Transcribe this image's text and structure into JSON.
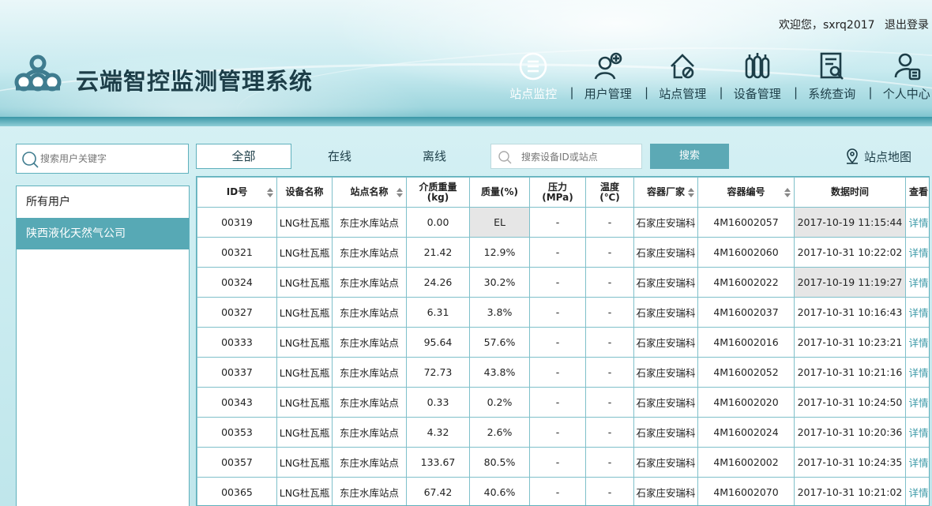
{
  "header": {
    "system_title": "云端智控监测管理系统",
    "welcome_text": "欢迎您，",
    "username": "sxrq2017",
    "logout_label": "退出登录",
    "nav": [
      {
        "label": "站点监控",
        "icon": "monitor-list-icon",
        "active": true
      },
      {
        "label": "用户管理",
        "icon": "user-add-icon"
      },
      {
        "label": "站点管理",
        "icon": "house-gear-icon"
      },
      {
        "label": "设备管理",
        "icon": "cylinders-icon"
      },
      {
        "label": "系统查询",
        "icon": "document-search-icon"
      },
      {
        "label": "个人中心",
        "icon": "person-card-icon"
      }
    ]
  },
  "sidebar": {
    "search_placeholder": "搜索用户关键字",
    "items": [
      {
        "label": "所有用户"
      },
      {
        "label": "陕西液化天然气公司",
        "selected": true
      }
    ]
  },
  "filters": {
    "all": "全部",
    "online": "在线",
    "offline": "离线",
    "search_placeholder": "搜索设备ID或站点",
    "search_button": "搜索",
    "map_link": "站点地图"
  },
  "table": {
    "columns": [
      "ID号",
      "设备名称",
      "站点名称",
      "介质重量\n(kg)",
      "质量(%)",
      "压力\n(MPa)",
      "温度\n(℃)",
      "容器厂家",
      "容器编号",
      "数据时间",
      "查看"
    ],
    "rows": [
      [
        "00319",
        "LNG杜瓦瓶",
        "东庄水库站点",
        "0.00",
        "EL",
        "-",
        "-",
        "石家庄安瑞科",
        "4M16002057",
        "2017-10-19 11:15:44",
        "详情"
      ],
      [
        "00321",
        "LNG杜瓦瓶",
        "东庄水库站点",
        "21.42",
        "12.9%",
        "-",
        "-",
        "石家庄安瑞科",
        "4M16002060",
        "2017-10-31 10:22:02",
        "详情"
      ],
      [
        "00324",
        "LNG杜瓦瓶",
        "东庄水库站点",
        "24.26",
        "30.2%",
        "-",
        "-",
        "石家庄安瑞科",
        "4M16002022",
        "2017-10-19 11:19:27",
        "详情"
      ],
      [
        "00327",
        "LNG杜瓦瓶",
        "东庄水库站点",
        "6.31",
        "3.8%",
        "-",
        "-",
        "石家庄安瑞科",
        "4M16002037",
        "2017-10-31 10:16:43",
        "详情"
      ],
      [
        "00333",
        "LNG杜瓦瓶",
        "东庄水库站点",
        "95.64",
        "57.6%",
        "-",
        "-",
        "石家庄安瑞科",
        "4M16002016",
        "2017-10-31 10:23:21",
        "详情"
      ],
      [
        "00337",
        "LNG杜瓦瓶",
        "东庄水库站点",
        "72.73",
        "43.8%",
        "-",
        "-",
        "石家庄安瑞科",
        "4M16002052",
        "2017-10-31 10:21:16",
        "详情"
      ],
      [
        "00343",
        "LNG杜瓦瓶",
        "东庄水库站点",
        "0.33",
        "0.2%",
        "-",
        "-",
        "石家庄安瑞科",
        "4M16002020",
        "2017-10-31 10:24:50",
        "详情"
      ],
      [
        "00353",
        "LNG杜瓦瓶",
        "东庄水库站点",
        "4.32",
        "2.6%",
        "-",
        "-",
        "石家庄安瑞科",
        "4M16002024",
        "2017-10-31 10:20:36",
        "详情"
      ],
      [
        "00357",
        "LNG杜瓦瓶",
        "东庄水库站点",
        "133.67",
        "80.5%",
        "-",
        "-",
        "石家庄安瑞科",
        "4M16002002",
        "2017-10-31 10:24:35",
        "详情"
      ],
      [
        "00365",
        "LNG杜瓦瓶",
        "东庄水库站点",
        "67.42",
        "40.6%",
        "-",
        "-",
        "石家庄安瑞科",
        "4M16002070",
        "2017-10-31 10:21:02",
        "详情"
      ]
    ]
  },
  "colors": {
    "accent": "#5ca9b5",
    "border": "#5fb0bc",
    "title": "#1d3e48",
    "link": "#3c9aa8",
    "shaded_cell": "#e6e6e6"
  }
}
